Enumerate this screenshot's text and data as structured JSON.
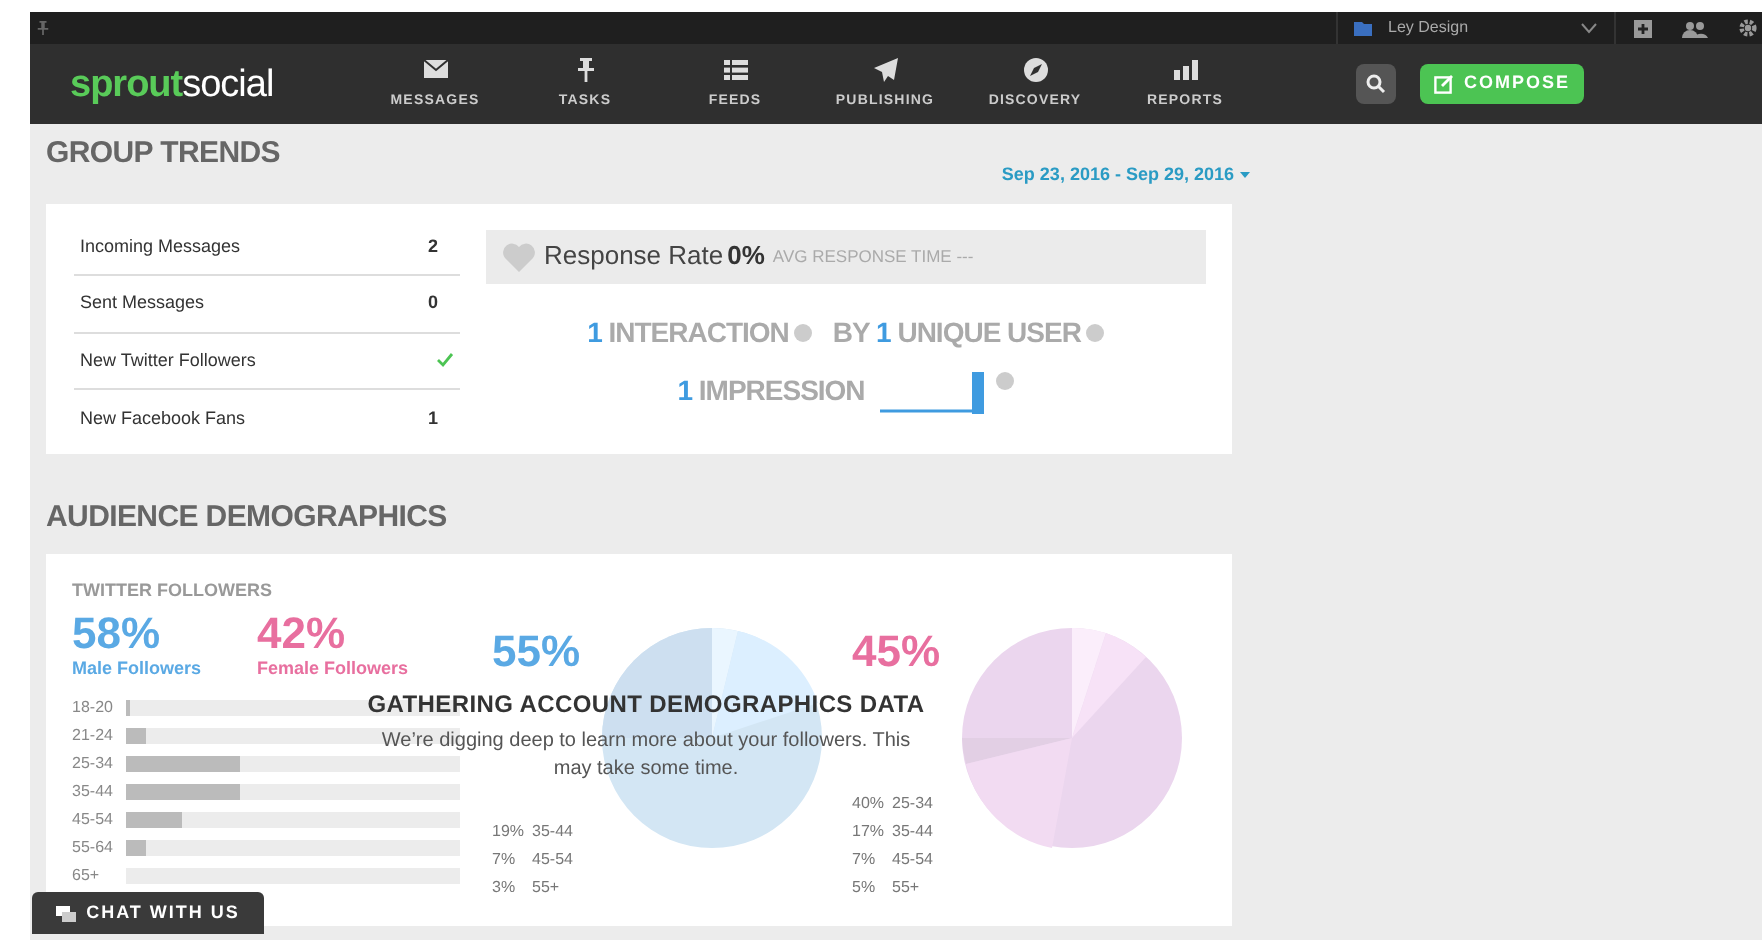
{
  "top_strip": {
    "account": "Ley Design"
  },
  "nav": {
    "logo": {
      "part_1": "sprout",
      "part_2": "social"
    },
    "items": [
      {
        "label": "MESSAGES"
      },
      {
        "label": "TASKS"
      },
      {
        "label": "FEEDS"
      },
      {
        "label": "PUBLISHING"
      },
      {
        "label": "DISCOVERY"
      },
      {
        "label": "REPORTS"
      }
    ],
    "compose": "COMPOSE"
  },
  "group_trends": {
    "title": "GROUP TRENDS",
    "date_range": "Sep 23, 2016 - Sep 29, 2016",
    "stats": [
      {
        "label": "Incoming Messages",
        "kind": "value",
        "value": "2"
      },
      {
        "label": "Sent Messages",
        "kind": "value",
        "value": "0"
      },
      {
        "label": "New Twitter Followers",
        "kind": "check"
      },
      {
        "label": "New Facebook Fans",
        "kind": "value",
        "value": "1"
      }
    ],
    "response": {
      "label": "Response Rate",
      "value": "0%",
      "avg_label": "AVG RESPONSE TIME",
      "avg_value": "---"
    },
    "interaction": {
      "count": "1",
      "label": "INTERACTION",
      "by": "BY",
      "users": "1",
      "users_label": "UNIQUE USER"
    },
    "impression": {
      "count": "1",
      "label": "IMPRESSION"
    }
  },
  "audience": {
    "title": "AUDIENCE DEMOGRAPHICS",
    "section": "TWITTER FOLLOWERS",
    "male": {
      "percent": "58%",
      "label": "Male Followers"
    },
    "female": {
      "percent": "42%",
      "label": "Female Followers"
    },
    "age_bars": [
      {
        "label": "18-20",
        "level": 0.01
      },
      {
        "label": "21-24",
        "level": 0.06
      },
      {
        "label": "25-34",
        "level": 0.34
      },
      {
        "label": "35-44",
        "level": 0.34
      },
      {
        "label": "45-54",
        "level": 0.17
      },
      {
        "label": "55-64",
        "level": 0.06
      },
      {
        "label": "65+"
      }
    ],
    "male_pie": {
      "percent": "55%",
      "legend": [
        {
          "percent": "19%",
          "range": "35-44"
        },
        {
          "percent": "7%",
          "range": "45-54"
        },
        {
          "percent": "3%",
          "range": "55+"
        }
      ]
    },
    "female_pie": {
      "percent": "45%",
      "legend": [
        {
          "percent": "40%",
          "range": "25-34"
        },
        {
          "percent": "17%",
          "range": "35-44"
        },
        {
          "percent": "7%",
          "range": "45-54"
        },
        {
          "percent": "5%",
          "range": "55+"
        }
      ]
    },
    "overlay": {
      "title": "GATHERING ACCOUNT DEMOGRAPHICS DATA",
      "text": "We’re digging deep to learn more about your followers. This may take some time."
    }
  },
  "chat": "CHAT WITH US"
}
